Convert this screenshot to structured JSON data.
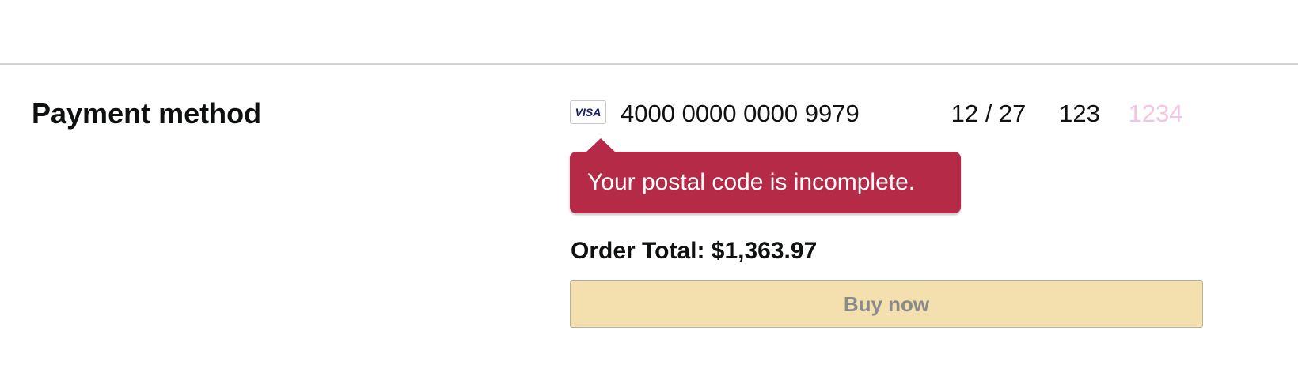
{
  "payment": {
    "title": "Payment method",
    "card": {
      "brand": "VISA",
      "number": "4000 0000 0000 9979",
      "expiry": "12 / 27",
      "cvc": "123",
      "postal_placeholder": "1234",
      "postal_value": ""
    },
    "error_message": "Your postal code is incomplete."
  },
  "order": {
    "total_label": "Order Total: $1,363.97",
    "buy_label": "Buy now"
  },
  "colors": {
    "error_background": "#b52a47",
    "buy_button_background": "#f4dfae",
    "placeholder_text": "#f2c6e2",
    "visa_brand": "#1a1f71"
  },
  "icons": {
    "card_brand": "visa-card-icon"
  }
}
